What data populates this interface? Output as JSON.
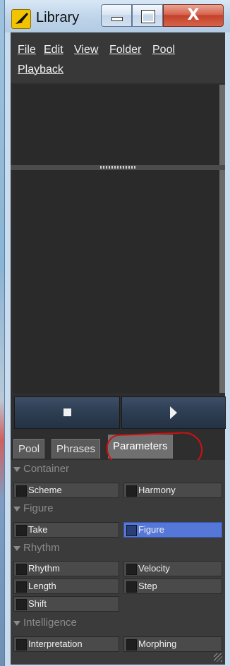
{
  "window": {
    "title": "Library",
    "minimize_glyph": "",
    "maximize_glyph": "",
    "close_glyph": "X"
  },
  "menu": {
    "items": [
      "File",
      "Edit",
      "View",
      "Folder",
      "Pool",
      "Playback"
    ]
  },
  "transport": {
    "stop_icon": "stop-icon",
    "play_icon": "play-icon"
  },
  "tabs": {
    "items": [
      "Pool",
      "Phrases",
      "Parameters"
    ],
    "active": "Parameters"
  },
  "parameters": {
    "sections": [
      {
        "title": "Container",
        "buttons": [
          {
            "label": "Scheme",
            "active": false
          },
          {
            "label": "Harmony",
            "active": false
          }
        ]
      },
      {
        "title": "Figure",
        "buttons": [
          {
            "label": "Take",
            "active": false
          },
          {
            "label": "Figure",
            "active": true
          }
        ]
      },
      {
        "title": "Rhythm",
        "buttons": [
          {
            "label": "Rhythm",
            "active": false
          },
          {
            "label": "Velocity",
            "active": false
          },
          {
            "label": "Length",
            "active": false
          },
          {
            "label": "Step",
            "active": false
          },
          {
            "label": "Shift",
            "active": false
          }
        ]
      },
      {
        "title": "Intelligence",
        "buttons": [
          {
            "label": "Interpretation",
            "active": false
          },
          {
            "label": "Morphing",
            "active": false
          }
        ]
      }
    ]
  },
  "colors": {
    "active_toggle": "#5577d8",
    "annotation": "#d01010"
  }
}
